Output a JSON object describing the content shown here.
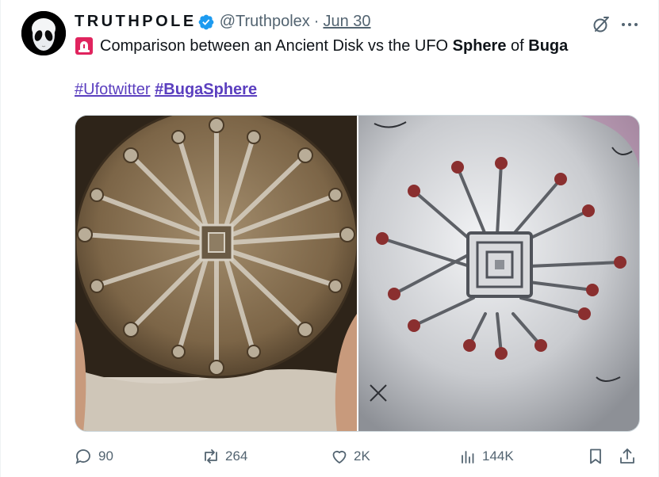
{
  "author": {
    "display_name": "TRUTHPOLE",
    "handle": "@Truthpolex",
    "separator": "·",
    "date": "Jun 30",
    "avatar_icon": "alien-head-icon",
    "verified_icon": "verified-badge-icon"
  },
  "tweet": {
    "emoji": "rotating-light-icon",
    "text_prefix": "Comparison between an Ancient Disk vs the UFO ",
    "text_bold1": "Sphere",
    "text_mid": " of ",
    "text_bold2": "Buga",
    "hashtags": [
      "#Ufotwitter",
      "#BugaSphere"
    ]
  },
  "media": {
    "left_image": "ancient-disk-photo",
    "right_image": "buga-sphere-photo"
  },
  "actions": {
    "replies": "90",
    "reposts": "264",
    "likes": "2K",
    "views": "144K"
  },
  "colors": {
    "hashtag": "#5b3fbf",
    "verified": "#1d9bf0",
    "muted": "#536471",
    "siren": "#e0245e"
  }
}
